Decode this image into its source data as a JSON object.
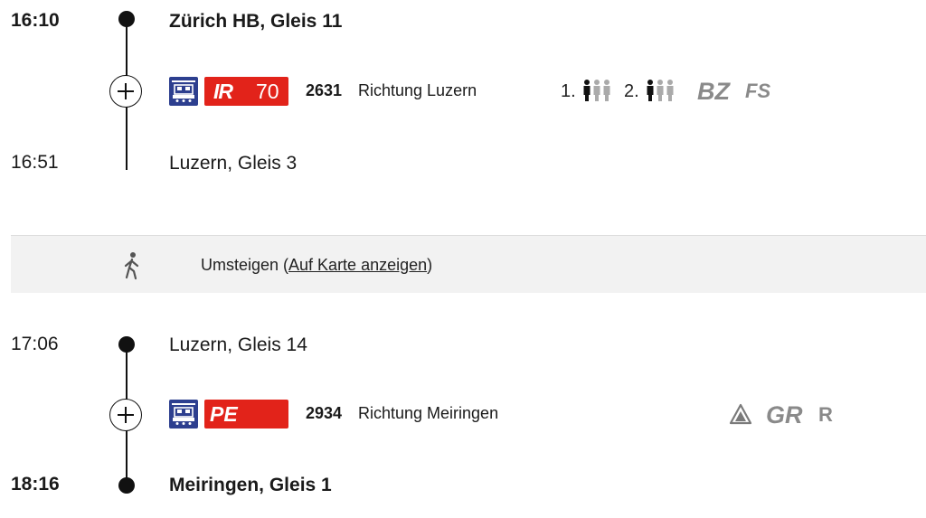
{
  "legs": [
    {
      "departure": {
        "time": "16:10",
        "station": "Zürich HB, Gleis 11"
      },
      "train": {
        "category": "IR",
        "line": "70",
        "number": "2631",
        "direction": "Richtung Luzern"
      },
      "occupancy": {
        "first": "1.",
        "second": "2."
      },
      "attributes": [
        "BZ",
        "FS"
      ],
      "arrival": {
        "time": "16:51",
        "station": "Luzern, Gleis 3"
      }
    },
    {
      "departure": {
        "time": "17:06",
        "station": "Luzern, Gleis 14"
      },
      "train": {
        "category": "PE",
        "number": "2934",
        "direction": "Richtung Meiringen"
      },
      "attributes": [
        "GR",
        "R"
      ],
      "arrival": {
        "time": "18:16",
        "station": "Meiringen, Gleis 1"
      }
    }
  ],
  "transfer": {
    "label": "Umsteigen (",
    "link": "Auf Karte anzeigen",
    "close": ")"
  },
  "colors": {
    "badge": "#e2231a",
    "train_icon": "#2d3f8f",
    "transfer_bg": "#f2f2f2"
  }
}
